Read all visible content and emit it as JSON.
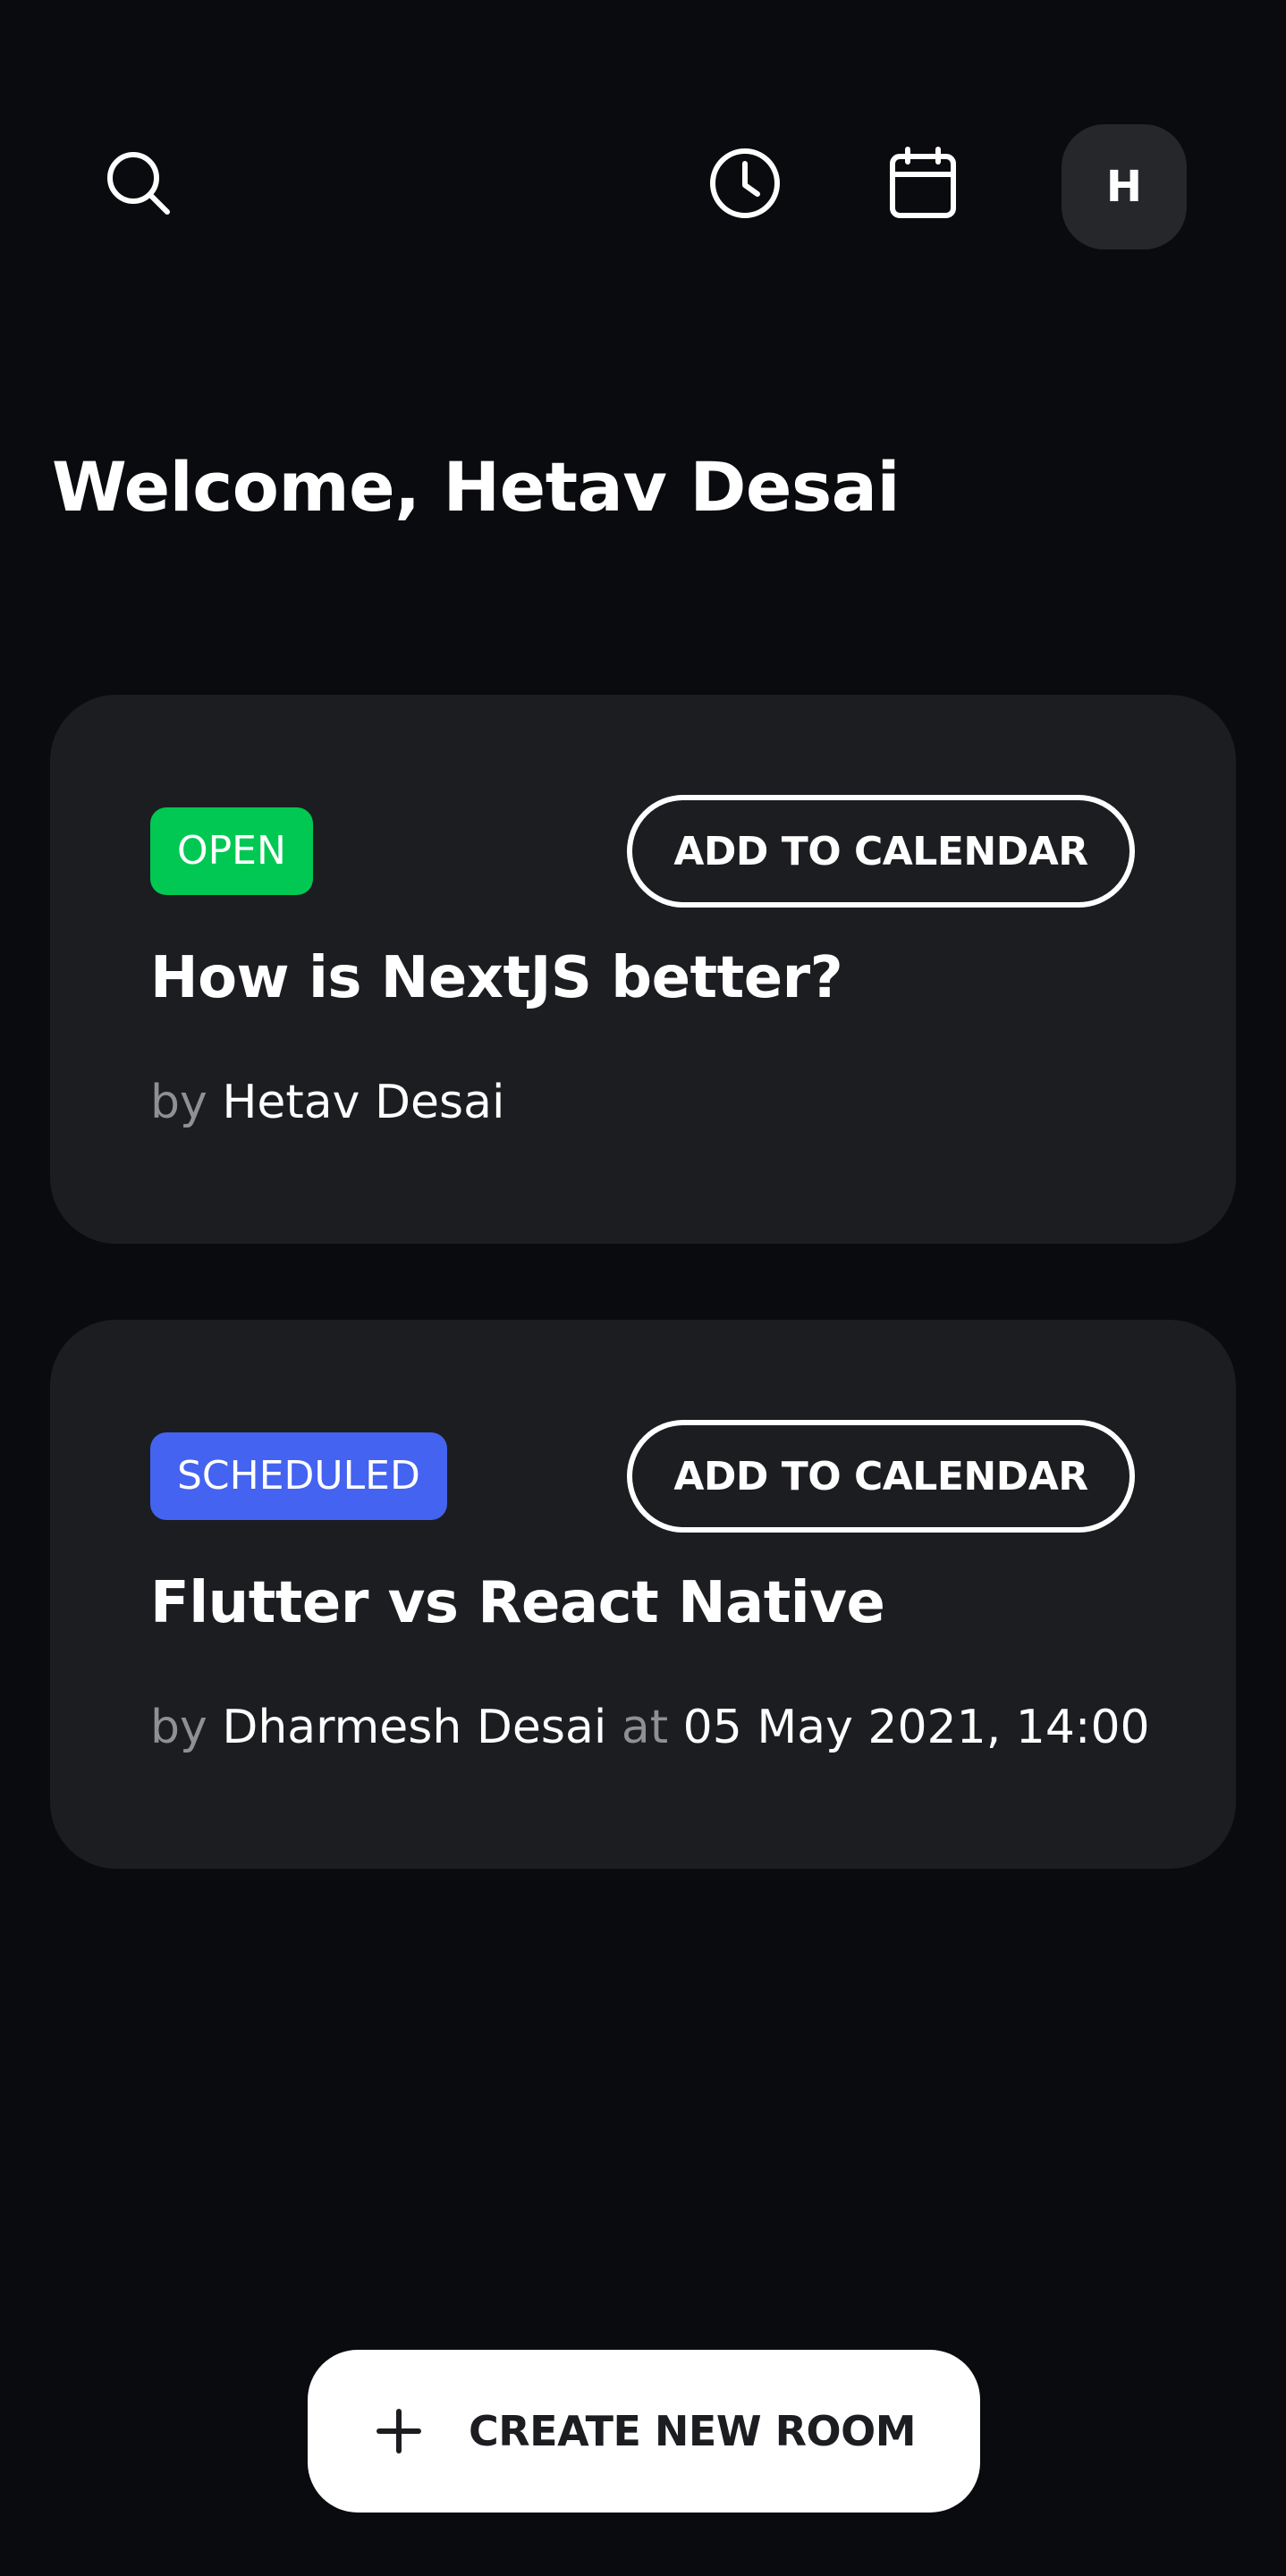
{
  "header": {
    "search_icon": "search-icon",
    "history_icon": "clock-icon",
    "calendar_icon": "calendar-icon",
    "avatar_initial": "H"
  },
  "welcome_text": "Welcome, Hetav Desai",
  "rooms": [
    {
      "status": "OPEN",
      "status_color": "#00c853",
      "calendar_label": "ADD TO CALENDAR",
      "title": "How is NextJS better?",
      "by_label": "by",
      "author": "Hetav Desai"
    },
    {
      "status": "SCHEDULED",
      "status_color": "#4463f0",
      "calendar_label": "ADD TO CALENDAR",
      "title": "Flutter vs React Native",
      "by_label": "by",
      "author": "Dharmesh Desai",
      "at_label": "at",
      "datetime": "05 May 2021, 14:00"
    }
  ],
  "create_button": {
    "icon": "plus-icon",
    "label": "CREATE NEW ROOM"
  },
  "colors": {
    "background": "#0a0b0e",
    "card": "#1c1d21",
    "avatar_bg": "#25272b",
    "muted_text": "#8e9094"
  }
}
